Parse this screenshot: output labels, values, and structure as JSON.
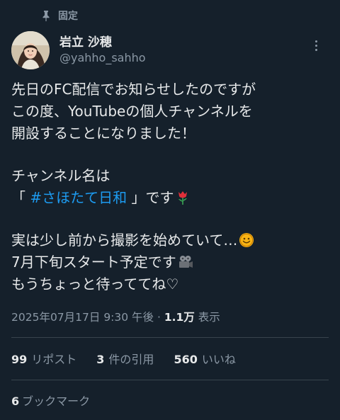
{
  "pinned": {
    "label": "固定",
    "icon": "pin-icon"
  },
  "author": {
    "display_name": "岩立 沙穂",
    "handle": "@yahho_sahho",
    "avatar_icon": "avatar-photo"
  },
  "menu": {
    "icon": "more-icon"
  },
  "tweet": {
    "line1": "先日のFC配信でお知らせしたのですが",
    "line2": "この度、YouTubeの個人チャンネルを",
    "line3": "開設することになりました！",
    "line4": "チャンネル名は",
    "line5_open": "「 ",
    "line5_hashtag": "#さほたて日和",
    "line5_close": " 」です",
    "line5_emoji": "tulip-emoji",
    "line6": "実は少し前から撮影を始めていて…",
    "line6_emoji": "smile-emoji",
    "line7": "7月下旬スタート予定です",
    "line7_emoji": "film-camera-emoji",
    "line8": "もうちょっと待っててね♡"
  },
  "meta": {
    "timestamp": "2025年07月17日 9:30 午後 · ",
    "views": "1.1万",
    "views_label": " 表示"
  },
  "stats": {
    "reposts_count": "99",
    "reposts_label": "リポスト",
    "quotes_count": "3",
    "quotes_label": "件の引用",
    "likes_count": "560",
    "likes_label": "いいね"
  },
  "bookmarks": {
    "count": "6",
    "label": "ブックマーク"
  },
  "colors": {
    "background": "#15202b",
    "text": "#e7e9ea",
    "secondary": "#8b98a5",
    "link": "#1d9bf0",
    "divider": "#38444d"
  }
}
